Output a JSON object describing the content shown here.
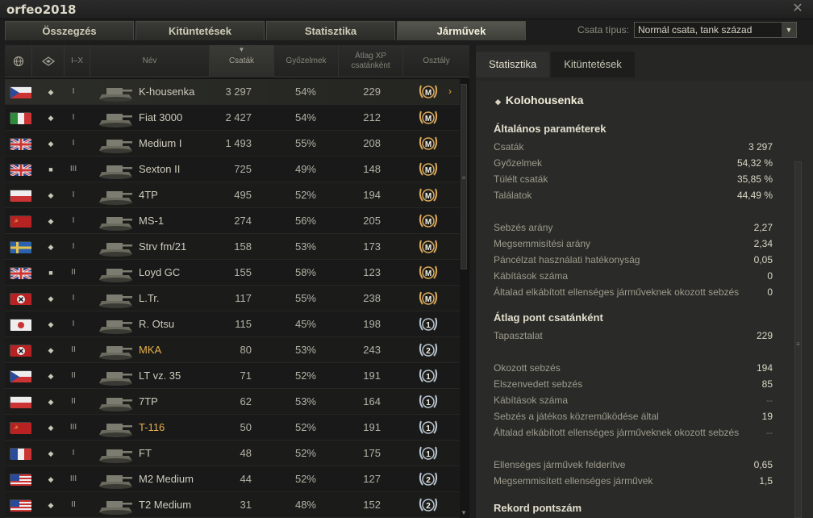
{
  "window": {
    "title": "orfeo2018",
    "close_icon": "close-icon"
  },
  "tabs": [
    {
      "label": "Összegzés",
      "active": false
    },
    {
      "label": "Kitüntetések",
      "active": false
    },
    {
      "label": "Statisztika",
      "active": false
    },
    {
      "label": "Járművek",
      "active": true
    }
  ],
  "battle_type": {
    "label": "Csata típus:",
    "value": "Normál csata, tank század"
  },
  "table": {
    "headers": {
      "nation": "",
      "type": "",
      "tier": "I–X",
      "name": "Név",
      "battles": "Csaták",
      "wins": "Győzelmek",
      "xp_line1": "Átlag XP",
      "xp_line2": "csatánként",
      "class": "Osztály"
    },
    "rows": [
      {
        "flag": "czech",
        "premium_mark": "◆",
        "tier": "I",
        "name": "K-housenka",
        "battles": "3 297",
        "wins": "54%",
        "xp": "229",
        "badge": "M",
        "premium": false
      },
      {
        "flag": "italy",
        "premium_mark": "◆",
        "tier": "I",
        "name": "Fiat 3000",
        "battles": "2 427",
        "wins": "54%",
        "xp": "212",
        "badge": "M",
        "premium": false
      },
      {
        "flag": "uk",
        "premium_mark": "◆",
        "tier": "I",
        "name": "Medium I",
        "battles": "1 493",
        "wins": "55%",
        "xp": "208",
        "badge": "M",
        "premium": false
      },
      {
        "flag": "uk",
        "premium_mark": "■",
        "tier": "III",
        "name": "Sexton II",
        "battles": "725",
        "wins": "49%",
        "xp": "148",
        "badge": "M",
        "premium": false
      },
      {
        "flag": "poland",
        "premium_mark": "◆",
        "tier": "I",
        "name": "4TP",
        "battles": "495",
        "wins": "52%",
        "xp": "194",
        "badge": "M",
        "premium": false
      },
      {
        "flag": "ussr",
        "premium_mark": "◆",
        "tier": "I",
        "name": "MS-1",
        "battles": "274",
        "wins": "56%",
        "xp": "205",
        "badge": "M",
        "premium": false
      },
      {
        "flag": "sweden",
        "premium_mark": "◆",
        "tier": "I",
        "name": "Strv fm/21",
        "battles": "158",
        "wins": "53%",
        "xp": "173",
        "badge": "M",
        "premium": false
      },
      {
        "flag": "uk",
        "premium_mark": "■",
        "tier": "II",
        "name": "Loyd GC",
        "battles": "155",
        "wins": "58%",
        "xp": "123",
        "badge": "M",
        "premium": false
      },
      {
        "flag": "germany",
        "premium_mark": "◆",
        "tier": "I",
        "name": "L.Tr.",
        "battles": "117",
        "wins": "55%",
        "xp": "238",
        "badge": "M",
        "premium": false
      },
      {
        "flag": "japan",
        "premium_mark": "◆",
        "tier": "I",
        "name": "R. Otsu",
        "battles": "115",
        "wins": "45%",
        "xp": "198",
        "badge": "1",
        "premium": false
      },
      {
        "flag": "germany",
        "premium_mark": "◆",
        "tier": "II",
        "name": "MKA",
        "battles": "80",
        "wins": "53%",
        "xp": "243",
        "badge": "2",
        "premium": true
      },
      {
        "flag": "czech",
        "premium_mark": "◆",
        "tier": "II",
        "name": "LT vz. 35",
        "battles": "71",
        "wins": "52%",
        "xp": "191",
        "badge": "1",
        "premium": false
      },
      {
        "flag": "poland",
        "premium_mark": "◆",
        "tier": "II",
        "name": "7TP",
        "battles": "62",
        "wins": "53%",
        "xp": "164",
        "badge": "1",
        "premium": false
      },
      {
        "flag": "ussr",
        "premium_mark": "◆",
        "tier": "III",
        "name": "T-116",
        "battles": "50",
        "wins": "52%",
        "xp": "191",
        "badge": "1",
        "premium": true
      },
      {
        "flag": "france",
        "premium_mark": "◆",
        "tier": "I",
        "name": "FT",
        "battles": "48",
        "wins": "52%",
        "xp": "175",
        "badge": "1",
        "premium": false
      },
      {
        "flag": "usa",
        "premium_mark": "◆",
        "tier": "III",
        "name": "M2 Medium",
        "battles": "44",
        "wins": "52%",
        "xp": "127",
        "badge": "2",
        "premium": false
      },
      {
        "flag": "usa",
        "premium_mark": "◆",
        "tier": "II",
        "name": "T2 Medium",
        "battles": "31",
        "wins": "48%",
        "xp": "152",
        "badge": "2",
        "premium": false
      }
    ]
  },
  "right_panel": {
    "tabs": [
      {
        "label": "Statisztika",
        "active": true
      },
      {
        "label": "Kitüntetések",
        "active": false
      }
    ],
    "vehicle_name": "Kolohousenka",
    "general_title": "Általános paraméterek",
    "general": [
      {
        "k": "Csaták",
        "v": "3 297"
      },
      {
        "k": "Győzelmek",
        "v": "54,32 %"
      },
      {
        "k": "Túlélt csaták",
        "v": "35,85 %"
      },
      {
        "k": "Találatok",
        "v": "44,49 %"
      }
    ],
    "ratios": [
      {
        "k": "Sebzés arány",
        "v": "2,27"
      },
      {
        "k": "Megsemmisítési arány",
        "v": "2,34"
      },
      {
        "k": "Páncélzat használati hatékonyság",
        "v": "0,05"
      },
      {
        "k": "Kábítások száma",
        "v": "0"
      },
      {
        "k": "Általad elkábított ellenséges járműveknek okozott sebzés",
        "v": "0"
      }
    ],
    "avg_title": "Átlag pont csatánként",
    "avg_xp": [
      {
        "k": "Tapasztalat",
        "v": "229"
      }
    ],
    "avg_damage": [
      {
        "k": "Okozott sebzés",
        "v": "194"
      },
      {
        "k": "Elszenvedett sebzés",
        "v": "85"
      },
      {
        "k": "Kábítások száma",
        "v": "--"
      },
      {
        "k": "Sebzés a játékos közreműködése által",
        "v": "19"
      },
      {
        "k": "Általad elkábított ellenséges járműveknek okozott sebzés",
        "v": "--"
      }
    ],
    "avg_enemies": [
      {
        "k": "Ellenséges járművek felderítve",
        "v": "0,65"
      },
      {
        "k": "Megsemmisített ellenséges járművek",
        "v": "1,5"
      }
    ],
    "record_title": "Rekord pontszám"
  }
}
